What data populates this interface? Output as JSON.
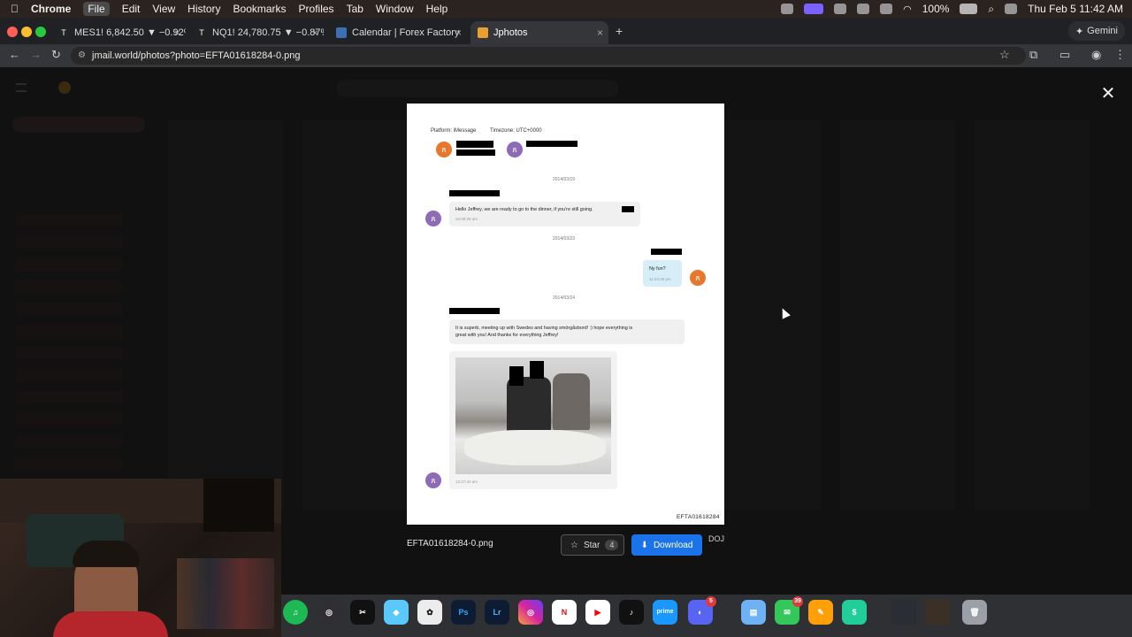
{
  "menubar": {
    "app": "Chrome",
    "items": [
      "File",
      "Edit",
      "View",
      "History",
      "Bookmarks",
      "Profiles",
      "Tab",
      "Window",
      "Help"
    ],
    "battery": "100%",
    "datetime": "Thu Feb 5  11:42 AM"
  },
  "tabs": [
    {
      "label": "MES1! 6,842.50 ▼ −0.92% G"
    },
    {
      "label": "NQ1! 24,780.75 ▼ −0.87% G"
    },
    {
      "label": "Calendar | Forex Factory"
    },
    {
      "label": "Jphotos"
    }
  ],
  "gemini_label": "Gemini",
  "address": {
    "url": "jmail.world/photos?photo=EFTA01618284-0.png"
  },
  "doc": {
    "platform": "Platform: iMessage",
    "timezone": "Timezone: UTC+0000",
    "date1": "2014/03/19",
    "msg1": "Hello Jeffrey, we are ready to go to the dinner, if you're still going.",
    "time1": "04:09:28 am",
    "date2": "2014/03/23",
    "msg2": "Ny fun?",
    "time2": "11:24:28 pm",
    "date3": "2014/03/24",
    "msg3_line1": "It is superb, meeting up with Swedes and having smörgåsbord! :) hope everything is",
    "msg3_line2": "great with you! And thanks for everything Jeffrey!",
    "time3": "12:27:44 am",
    "footer_id": "EFTA01618284"
  },
  "lightbox": {
    "filename": "EFTA01618284-0.png",
    "star_label": "Star",
    "star_count": "4",
    "download_label": "Download",
    "source_tag": "DOJ"
  },
  "dock_badges": {
    "messages": "39",
    "discord": "5"
  }
}
